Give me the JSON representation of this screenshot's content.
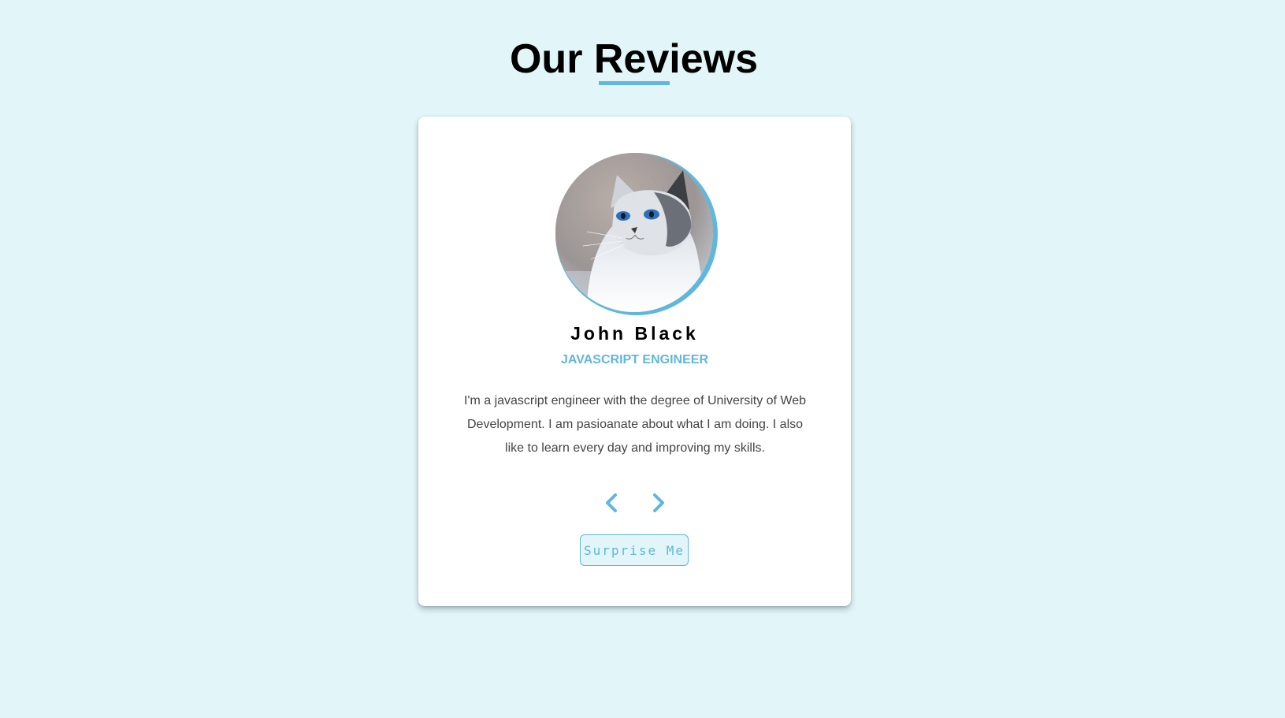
{
  "page": {
    "title": "Our Reviews",
    "background": "#e2f6f9",
    "accent_color": "#5fb7dc"
  },
  "review": {
    "avatar_icon": "cat-photo",
    "name": "John Black",
    "job": "JAVASCRIPT ENGINEER",
    "text": "I'm a javascript engineer with the degree of University of Web Development. I am pasioanate about what I am doing. I also like to learn every day and improving my skills."
  },
  "controls": {
    "prev_icon": "chevron-left-icon",
    "next_icon": "chevron-right-icon",
    "surprise_label": "Surprise Me"
  }
}
